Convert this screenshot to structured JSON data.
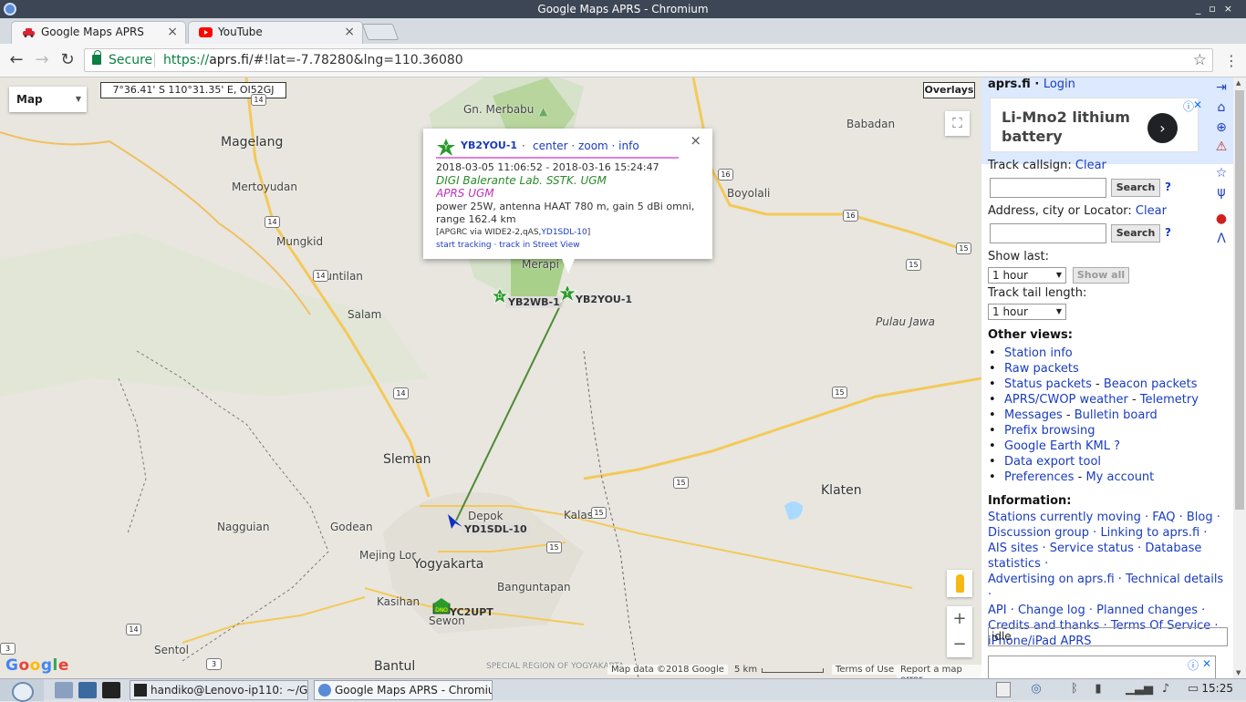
{
  "window": {
    "title": "Google Maps APRS - Chromium"
  },
  "tabs": [
    {
      "label": "Google Maps APRS",
      "active": true
    },
    {
      "label": "YouTube",
      "active": false
    }
  ],
  "toolbar": {
    "secure_label": "Secure",
    "url_scheme": "https://",
    "url_host": "aprs.fi",
    "url_path": "/#!lat=-7.78280&lng=110.36080"
  },
  "map": {
    "type_select": "Map",
    "coordinates": "7°36.41' S 110°31.35' E, OI52GJ",
    "overlays_button": "Overlays",
    "places": [
      {
        "name": "Gn. Merbabu"
      },
      {
        "name": "Magelang"
      },
      {
        "name": "Mertoyudan"
      },
      {
        "name": "Mungkid"
      },
      {
        "name": "Muntilan"
      },
      {
        "name": "Salam"
      },
      {
        "name": "Merapi"
      },
      {
        "name": "Babadan"
      },
      {
        "name": "Boyolali"
      },
      {
        "name": "Pulau Jawa"
      },
      {
        "name": "Sleman"
      },
      {
        "name": "Depok"
      },
      {
        "name": "Kalasan"
      },
      {
        "name": "Klaten"
      },
      {
        "name": "Nagguian"
      },
      {
        "name": "Godean"
      },
      {
        "name": "Mejing Lor"
      },
      {
        "name": "Yogyakarta"
      },
      {
        "name": "Banguntapan"
      },
      {
        "name": "Kasihan"
      },
      {
        "name": "Sewon"
      },
      {
        "name": "Sentol"
      },
      {
        "name": "Bantul"
      },
      {
        "name": "SPECIAL REGION OF YOGYAKARTA"
      }
    ],
    "road_shields": [
      "14",
      "14",
      "14",
      "14",
      "16",
      "16",
      "15",
      "15",
      "15",
      "15",
      "15",
      "14",
      "15",
      "3",
      "3"
    ],
    "stations": [
      {
        "call": "YB2WB-1"
      },
      {
        "call": "YB2YOU-1"
      },
      {
        "call": "YD1SDL-10"
      },
      {
        "call": "YC2UPT"
      }
    ],
    "popup": {
      "call": "YB2YOU-1",
      "links": "center · zoom · info",
      "date_range": "2018-03-05 11:06:52 - 2018-03-16 15:24:47",
      "comment": "DIGI Balerante Lab. SSTK. UGM",
      "network": "APRS UGM",
      "specs_1": "power 25W, antenna HAAT 780 m, gain 5 dBi omni,",
      "specs_2": "range 162.4 km",
      "path_prefix": "[APGRC via WIDE2-2,qAS,",
      "path_link": "YD1SDL-10",
      "path_suffix": "]",
      "actions": "start tracking · track in Street View"
    },
    "footer": {
      "map_data": "Map data ©2018 Google",
      "scale": "5 km",
      "terms": "Terms of Use",
      "report": "Report a map error"
    },
    "google_logo": [
      "G",
      "o",
      "o",
      "g",
      "l",
      "e"
    ]
  },
  "sidebar": {
    "brand": "aprs.fi",
    "login": "Login",
    "ad_text": "Li-Mno2 lithium battery",
    "track_label": "Track callsign:",
    "clear1": "Clear",
    "search_btn": "Search",
    "help": "?",
    "address_label": "Address, city or Locator:",
    "clear2": "Clear",
    "show_last_label": "Show last:",
    "show_last_value": "1 hour",
    "show_all_btn": "Show all",
    "tail_label": "Track tail length:",
    "tail_value": "1 hour",
    "other_views_heading": "Other views:",
    "other_views": [
      {
        "parts": [
          "Station info"
        ]
      },
      {
        "parts": [
          "Raw packets"
        ]
      },
      {
        "parts": [
          "Status packets",
          "Beacon packets"
        ]
      },
      {
        "parts": [
          "APRS/CWOP weather",
          "Telemetry"
        ]
      },
      {
        "parts": [
          "Messages",
          "Bulletin board"
        ]
      },
      {
        "parts": [
          "Prefix browsing"
        ]
      },
      {
        "parts": [
          "Google Earth KML ?"
        ]
      },
      {
        "parts": [
          "Data export tool"
        ]
      },
      {
        "parts": [
          "Preferences",
          "My account"
        ]
      }
    ],
    "information_heading": "Information:",
    "information_links": [
      "Stations currently moving",
      "FAQ",
      "Blog",
      "Discussion group",
      "Linking to aprs.fi",
      "AIS sites",
      "Service status",
      "Database statistics",
      "Advertising on aprs.fi",
      "Technical details",
      "API",
      "Change log",
      "Planned changes",
      "Credits and thanks",
      "Terms Of Service",
      "iPhone/iPad APRS"
    ],
    "status": "idle"
  },
  "taskbar": {
    "tasks": [
      {
        "label": "handiko@Lenovo-ip110: ~/G..."
      },
      {
        "label": "Google Maps APRS - Chromium"
      }
    ],
    "clock": "15:25"
  }
}
